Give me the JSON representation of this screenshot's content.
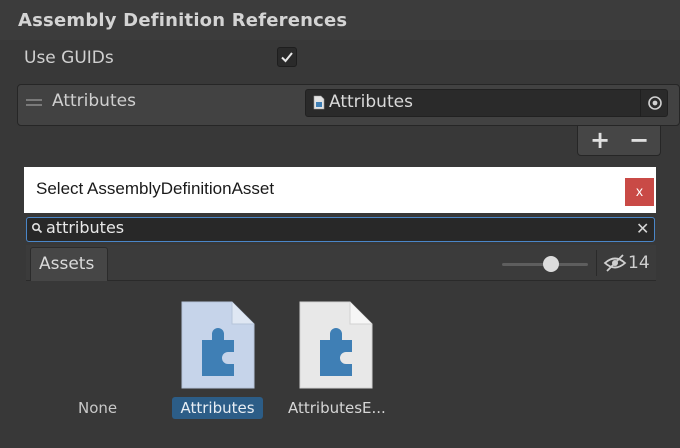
{
  "inspector": {
    "section_title": "Assembly Definition References",
    "use_guids_label": "Use GUIDs",
    "use_guids_checked": true,
    "list_item_label": "Attributes",
    "object_field_value": "Attributes",
    "add_button": "+",
    "remove_button": "−"
  },
  "dialog": {
    "title": "Select AssemblyDefinitionAsset",
    "close_glyph": "x",
    "search_value": "attributes",
    "search_clear_glyph": "✕",
    "tab_label": "Assets",
    "hidden_count": "14",
    "items": [
      {
        "label": "None"
      },
      {
        "label": "Attributes",
        "selected": true
      },
      {
        "label": "AttributesE..."
      }
    ]
  },
  "colors": {
    "accent": "#4a86c8",
    "selection": "#2c5d87",
    "close_button": "#c94a46",
    "asset_icon_blue": "#3f7fb5"
  },
  "icons": [
    "checkmark-icon",
    "drag-handle-icon",
    "asset-file-icon",
    "object-picker-icon",
    "search-icon",
    "clear-icon",
    "eye-hidden-icon",
    "puzzle-asset-icon"
  ]
}
